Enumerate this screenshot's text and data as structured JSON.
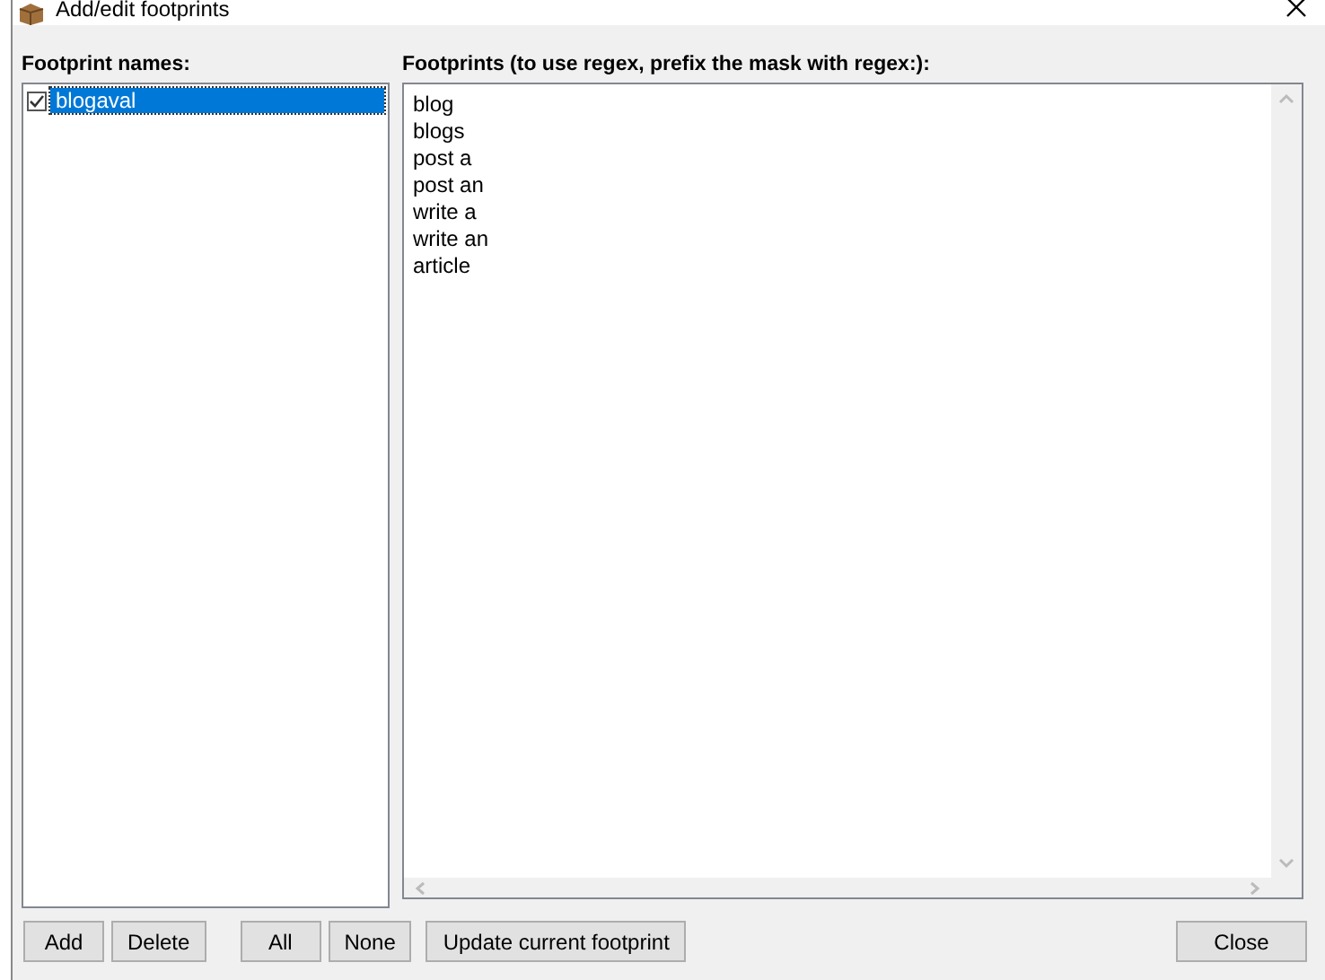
{
  "window": {
    "title": "Add/edit footprints"
  },
  "names_panel": {
    "label": "Footprint names:",
    "items": [
      {
        "label": "blogaval",
        "checked": true,
        "selected": true
      }
    ]
  },
  "footprints_panel": {
    "label": "Footprints (to use regex, prefix the mask with regex:):",
    "lines": [
      "blog",
      "blogs",
      "post a",
      "post an",
      "write a",
      "write an",
      "article"
    ]
  },
  "buttons": [
    {
      "label": "Add",
      "kind": "left"
    },
    {
      "label": "Delete",
      "kind": "left"
    },
    {
      "label": "All",
      "kind": "gap"
    },
    {
      "label": "None",
      "kind": "left"
    },
    {
      "label": "Update current footprint",
      "kind": "left"
    },
    {
      "label": "Close",
      "kind": "right"
    }
  ]
}
